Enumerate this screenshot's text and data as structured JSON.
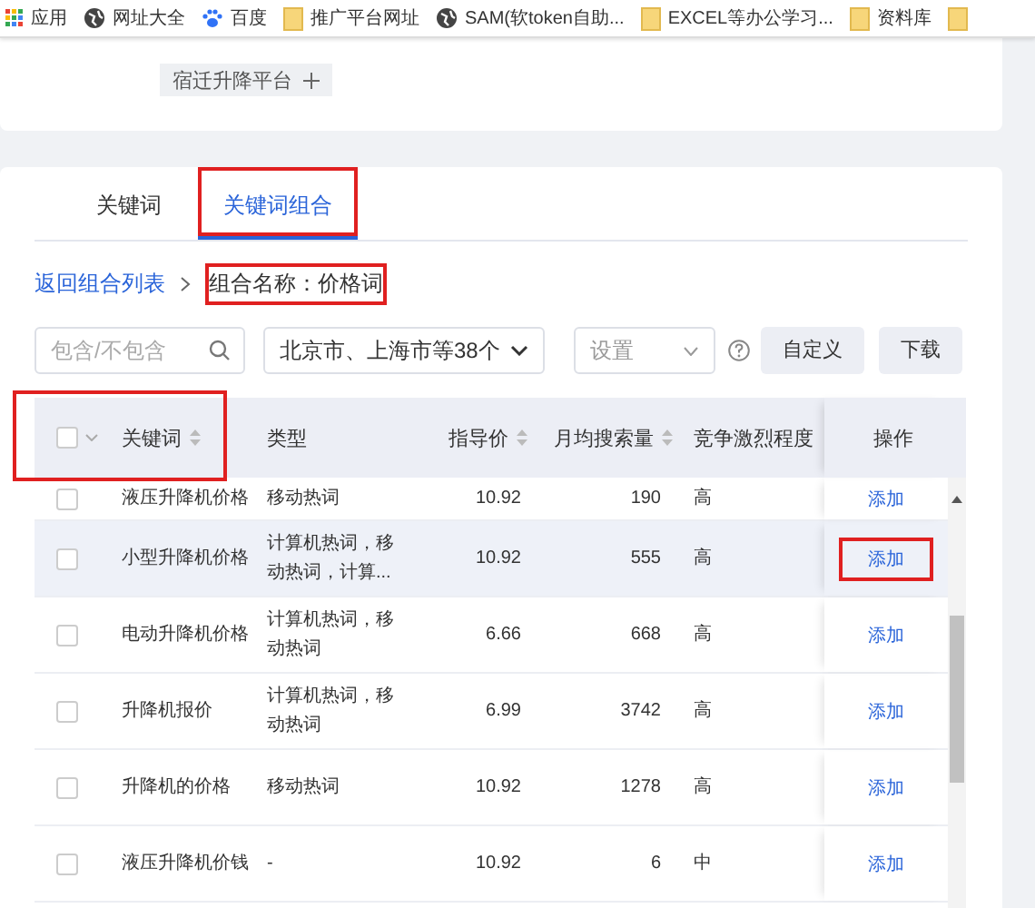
{
  "bookmarks": [
    {
      "kind": "apps",
      "label": "应用"
    },
    {
      "kind": "globe",
      "label": "网址大全"
    },
    {
      "kind": "paw",
      "label": "百度"
    },
    {
      "kind": "folder",
      "label": "推广平台网址"
    },
    {
      "kind": "globe",
      "label": "SAM(软token自助..."
    },
    {
      "kind": "folder",
      "label": "EXCEL等办公学习..."
    },
    {
      "kind": "folder",
      "label": "资料库"
    },
    {
      "kind": "folder"
    }
  ],
  "tag": {
    "label": "宿迁升降平台"
  },
  "tabs": [
    {
      "label": "关键词",
      "selected": false,
      "highlighted": false
    },
    {
      "label": "关键词组合",
      "selected": true,
      "highlighted": true
    }
  ],
  "breadcrumb": {
    "back_link": "返回组合列表",
    "current": "组合名称：价格词",
    "current_highlighted": true
  },
  "toolbar": {
    "search": {
      "placeholder": "包含/不包含"
    },
    "region_select": {
      "value": "北京市、上海市等38个"
    },
    "settings_select": {
      "placeholder": "设置"
    },
    "custom_button": "自定义",
    "download_button": "下载"
  },
  "table": {
    "header_highlighted": true,
    "select_all_checked": false,
    "columns": [
      "关键词",
      "类型",
      "指导价",
      "月均搜索量",
      "竞争激烈程度",
      "操作"
    ],
    "rows": [
      {
        "keyword": "液压升降机价格",
        "type": "移动热词",
        "price": "10.92",
        "searches": "190",
        "competition": "高",
        "action": "添加",
        "checked": false,
        "hovered": false,
        "action_highlighted": false
      },
      {
        "keyword": "小型升降机价格",
        "type": "计算机热词，移动热词，计算...",
        "price": "10.92",
        "searches": "555",
        "competition": "高",
        "action": "添加",
        "checked": false,
        "hovered": true,
        "action_highlighted": true
      },
      {
        "keyword": "电动升降机价格",
        "type": "计算机热词，移动热词",
        "price": "6.66",
        "searches": "668",
        "competition": "高",
        "action": "添加",
        "checked": false,
        "hovered": false,
        "action_highlighted": false
      },
      {
        "keyword": "升降机报价",
        "type": "计算机热词，移动热词",
        "price": "6.99",
        "searches": "3742",
        "competition": "高",
        "action": "添加",
        "checked": false,
        "hovered": false,
        "action_highlighted": false
      },
      {
        "keyword": "升降机的价格",
        "type": "移动热词",
        "price": "10.92",
        "searches": "1278",
        "competition": "高",
        "action": "添加",
        "checked": false,
        "hovered": false,
        "action_highlighted": false
      },
      {
        "keyword": "液压升降机价钱",
        "type": "-",
        "price": "10.92",
        "searches": "6",
        "competition": "中",
        "action": "添加",
        "checked": false,
        "hovered": false,
        "action_highlighted": false
      }
    ]
  }
}
